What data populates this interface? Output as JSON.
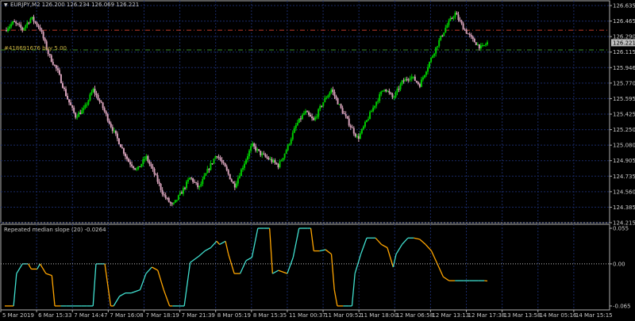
{
  "header": {
    "symbol_line": "EURJPY,M2  126.200 126.234 126.069 126.221",
    "order_label": "#418691676 buy 5.00",
    "indicator_label": "Repeated median slope (20) -0.0264"
  },
  "colors": {
    "background": "#000000",
    "grid": "#1a2a66",
    "axis_text": "#c8c8c8",
    "bull_candle": "#00c800",
    "bear_candle": "#d4a0b8",
    "sell_line": "#c0392b",
    "buy_line": "#3a8f2a",
    "slope_up": "#40e0d0",
    "slope_down": "#ffa500",
    "current_price_box": "#c0c0c0"
  },
  "price_axis": {
    "labels": [
      "126.635",
      "126.465",
      "126.290",
      "126.115",
      "125.946",
      "125.770",
      "125.595",
      "125.425",
      "125.250",
      "125.080",
      "124.905",
      "124.735",
      "124.560",
      "124.385",
      "124.215"
    ],
    "current_price": "126.221"
  },
  "indicator_axis": {
    "labels": [
      "0.055",
      "0.00",
      "-0.065"
    ]
  },
  "time_axis": {
    "labels": [
      "5 Mar 2019",
      "6 Mar 15:33",
      "7 Mar 14:47",
      "7 Mar 16:08",
      "7 Mar 18:19",
      "7 Mar 21:39",
      "8 Mar 05:19",
      "8 Mar 15:35",
      "11 Mar 00:37",
      "11 Mar 09:52",
      "11 Mar 18:00",
      "12 Mar 06:58",
      "12 Mar 13:13",
      "12 Mar 17:38",
      "13 Mar 13:58",
      "14 Mar 05:16",
      "14 Mar 15:15"
    ]
  },
  "chart_data": [
    {
      "type": "candlestick",
      "symbol": "EURJPY,M2",
      "ylim": [
        124.215,
        126.635
      ],
      "sell_level": 126.36,
      "buy_level": 126.14,
      "close_path": [
        [
          0,
          126.36
        ],
        [
          3,
          126.45
        ],
        [
          6,
          126.37
        ],
        [
          9,
          126.5
        ],
        [
          12,
          126.38
        ],
        [
          15,
          126.08
        ],
        [
          18,
          125.9
        ],
        [
          21,
          125.62
        ],
        [
          24,
          125.4
        ],
        [
          27,
          125.48
        ],
        [
          30,
          125.7
        ],
        [
          33,
          125.52
        ],
        [
          36,
          125.3
        ],
        [
          39,
          125.1
        ],
        [
          42,
          124.9
        ],
        [
          45,
          124.8
        ],
        [
          48,
          124.95
        ],
        [
          51,
          124.75
        ],
        [
          54,
          124.52
        ],
        [
          57,
          124.4
        ],
        [
          60,
          124.55
        ],
        [
          63,
          124.72
        ],
        [
          66,
          124.6
        ],
        [
          69,
          124.8
        ],
        [
          72,
          124.98
        ],
        [
          75,
          124.82
        ],
        [
          78,
          124.62
        ],
        [
          81,
          124.85
        ],
        [
          84,
          125.08
        ],
        [
          87,
          124.98
        ],
        [
          90,
          124.92
        ],
        [
          93,
          124.85
        ],
        [
          96,
          125.05
        ],
        [
          99,
          125.3
        ],
        [
          102,
          125.45
        ],
        [
          105,
          125.35
        ],
        [
          108,
          125.55
        ],
        [
          111,
          125.7
        ],
        [
          114,
          125.5
        ],
        [
          117,
          125.32
        ],
        [
          120,
          125.15
        ],
        [
          123,
          125.35
        ],
        [
          126,
          125.55
        ],
        [
          129,
          125.72
        ],
        [
          132,
          125.6
        ],
        [
          135,
          125.78
        ],
        [
          138,
          125.85
        ],
        [
          141,
          125.75
        ],
        [
          144,
          125.98
        ],
        [
          147,
          126.2
        ],
        [
          150,
          126.4
        ],
        [
          153,
          126.55
        ],
        [
          156,
          126.38
        ],
        [
          159,
          126.25
        ],
        [
          162,
          126.16
        ],
        [
          164,
          126.221
        ]
      ]
    },
    {
      "type": "line",
      "name": "Repeated median slope (20)",
      "ylim": [
        -0.065,
        0.055
      ],
      "current_value": -0.0264,
      "x": [
        0,
        3,
        4,
        6,
        8,
        9,
        11,
        12,
        14,
        16,
        17,
        19,
        21,
        23,
        26,
        28,
        30,
        31,
        34,
        36,
        37,
        39,
        41,
        43,
        46,
        48,
        50,
        52,
        54,
        56,
        57,
        59,
        61,
        63,
        66,
        68,
        70,
        72,
        73,
        75,
        76,
        78,
        80,
        82,
        84,
        86,
        88,
        90,
        91,
        93,
        96,
        98,
        100,
        103,
        104,
        105,
        107,
        109,
        111,
        112,
        113,
        115,
        117,
        118,
        119,
        121,
        123,
        126,
        128,
        130,
        132,
        133,
        135,
        137,
        139,
        141,
        143,
        145,
        147,
        149,
        151,
        153,
        156,
        158,
        161,
        163,
        164
      ],
      "values": [
        -0.065,
        -0.065,
        -0.015,
        0.0,
        0.0,
        -0.008,
        -0.008,
        0.0,
        -0.015,
        -0.018,
        -0.065,
        -0.065,
        -0.065,
        -0.065,
        -0.065,
        -0.065,
        -0.065,
        0.0,
        0.0,
        -0.065,
        -0.065,
        -0.05,
        -0.045,
        -0.045,
        -0.04,
        -0.015,
        -0.005,
        -0.01,
        -0.04,
        -0.065,
        -0.065,
        -0.065,
        -0.065,
        0.002,
        0.012,
        0.02,
        0.025,
        0.035,
        0.03,
        0.035,
        0.015,
        -0.015,
        -0.015,
        0.005,
        0.01,
        0.055,
        0.055,
        0.055,
        -0.015,
        -0.01,
        -0.015,
        0.01,
        0.055,
        0.055,
        0.055,
        0.02,
        0.02,
        0.022,
        0.015,
        -0.04,
        -0.065,
        -0.065,
        -0.065,
        -0.065,
        -0.015,
        0.015,
        0.04,
        0.04,
        0.03,
        0.025,
        -0.005,
        0.015,
        0.03,
        0.04,
        0.04,
        0.038,
        0.03,
        0.02,
        0.0,
        -0.02,
        -0.026,
        -0.026,
        -0.026,
        -0.026,
        -0.026,
        -0.026,
        -0.0264
      ],
      "colors": {
        "up": "#40e0d0",
        "down": "#ffa500"
      }
    }
  ]
}
